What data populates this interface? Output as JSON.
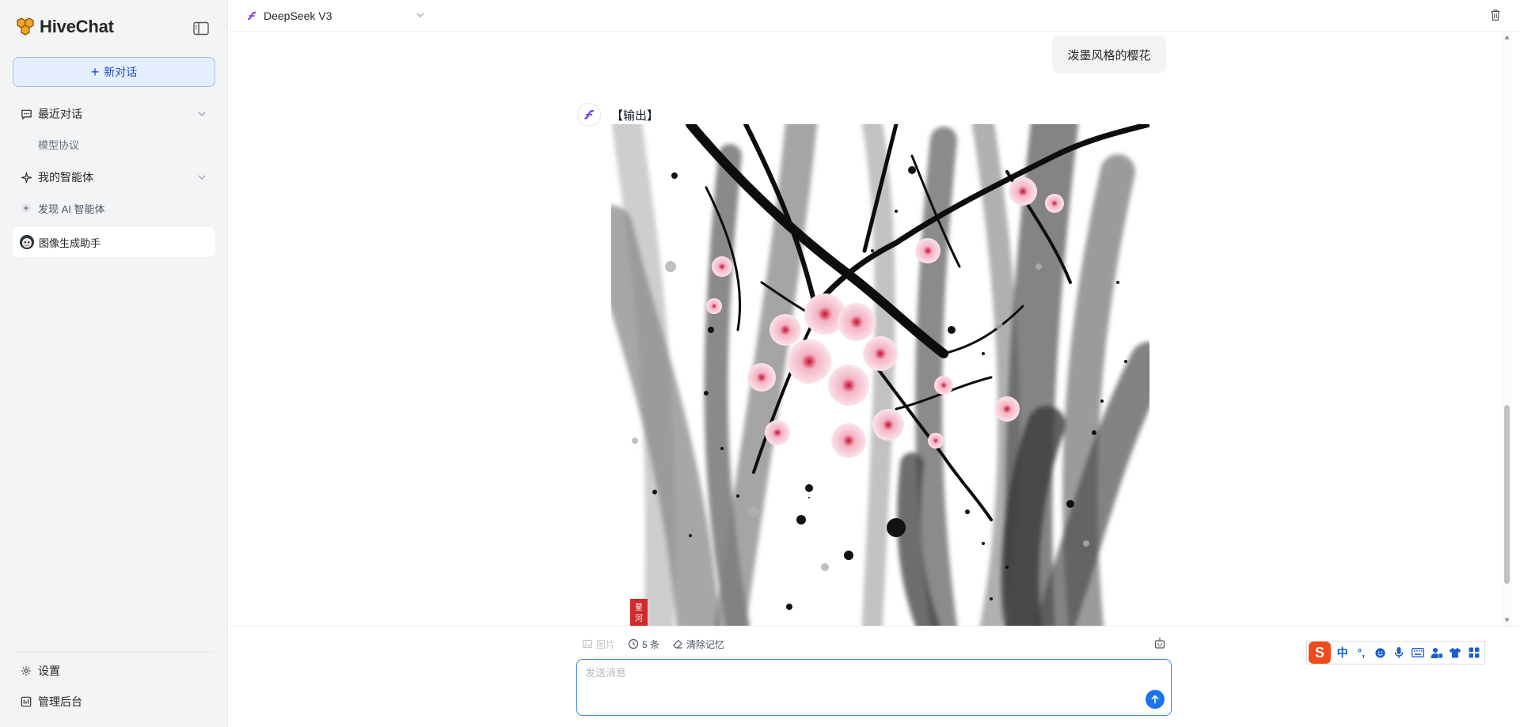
{
  "app": {
    "name": "HiveChat"
  },
  "sidebar": {
    "new_chat_label": "新对话",
    "recent_section_label": "最近对话",
    "recent_items": [
      {
        "label": "模型协议"
      }
    ],
    "agents_section_label": "我的智能体",
    "discover_label": "发现 AI 智能体",
    "active_agent_label": "图像生成助手",
    "settings_label": "设置",
    "admin_label": "管理后台"
  },
  "header": {
    "model_name": "DeepSeek V3"
  },
  "chat": {
    "user_message": "泼墨风格的樱花",
    "bot_message": "【输出】",
    "image_seal_text": "星河"
  },
  "composer": {
    "image_label": "图片",
    "history_count_label": "5 条",
    "clear_memory_label": "清除记忆",
    "placeholder": "发送消息"
  },
  "ime": {
    "mode_label": "中",
    "punct_label": "°,"
  },
  "colors": {
    "accent": "#3b82f6",
    "send_button": "#1d73e8",
    "model_icon": "#7c3aed",
    "brand_logo": "#f5a623"
  }
}
